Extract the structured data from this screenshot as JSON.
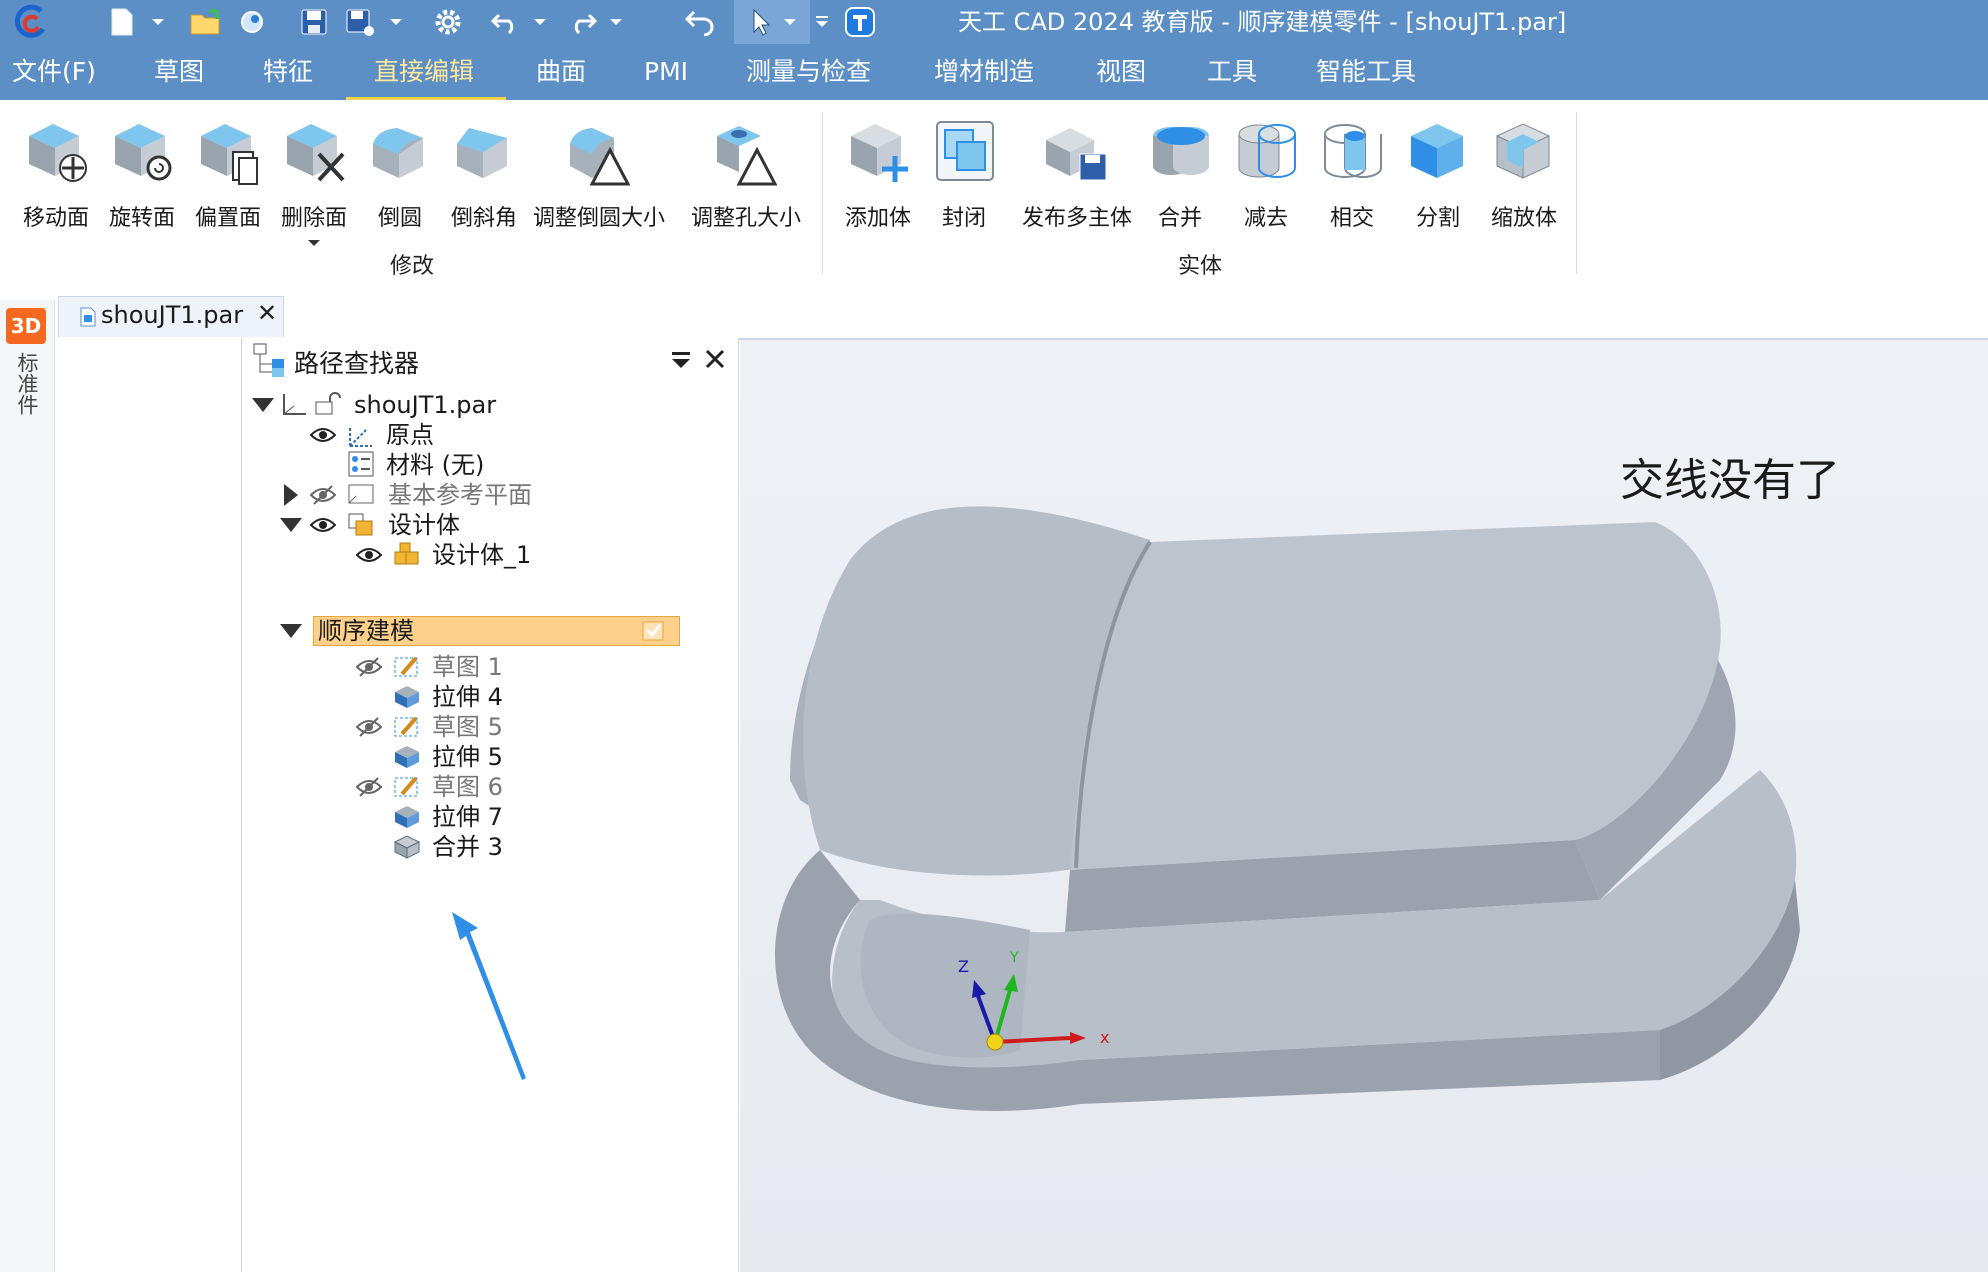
{
  "app": {
    "title": "天工 CAD 2024 教育版 - 顺序建模零件 - [shouJT1.par]"
  },
  "quick_access": [
    "app-logo-icon",
    "new-file-icon",
    "dropdown-arrow-icon",
    "open-folder-icon",
    "globe-icon",
    "save-icon",
    "save-as-icon",
    "dropdown-arrow-icon",
    "settings-gear-icon",
    "undo-icon",
    "dropdown-arrow-icon",
    "redo-icon",
    "dropdown-arrow-icon",
    "rollback-icon",
    "select-cursor-icon",
    "customize-qa-icon",
    "t-brand-icon"
  ],
  "menu": {
    "items": [
      "文件(F)",
      "草图",
      "特征",
      "直接编辑",
      "曲面",
      "PMI",
      "测量与检查",
      "增材制造",
      "视图",
      "工具",
      "智能工具"
    ],
    "active": "直接编辑"
  },
  "ribbon": {
    "modify_group": {
      "label": "修改",
      "buttons": [
        "移动面",
        "旋转面",
        "偏置面",
        "删除面",
        "倒圆",
        "倒斜角",
        "调整倒圆大小",
        "调整孔大小"
      ]
    },
    "solid_group": {
      "label": "实体",
      "buttons": [
        "添加体",
        "封闭",
        "发布多主体",
        "合并",
        "减去",
        "相交",
        "分割",
        "缩放体"
      ]
    }
  },
  "document_tab": {
    "label": "shouJT1.par",
    "close": "✕"
  },
  "side_strip": {
    "badge": "3D",
    "label": "标准件"
  },
  "pathfinder": {
    "title": "路径查找器",
    "items": [
      {
        "label": "shouJT1.par",
        "dimmed": false
      },
      {
        "label": "原点",
        "dimmed": false
      },
      {
        "label": "材料 (无)",
        "dimmed": false
      },
      {
        "label": "基本参考平面",
        "dimmed": true
      },
      {
        "label": "设计体",
        "dimmed": false
      },
      {
        "label": "设计体_1",
        "dimmed": false
      },
      {
        "label": "顺序建模",
        "dimmed": false,
        "selected": true
      },
      {
        "label": "草图 1",
        "dimmed": true
      },
      {
        "label": "拉伸 4",
        "dimmed": false
      },
      {
        "label": "草图 5",
        "dimmed": true
      },
      {
        "label": "拉伸 5",
        "dimmed": false
      },
      {
        "label": "草图 6",
        "dimmed": true
      },
      {
        "label": "拉伸 7",
        "dimmed": false
      },
      {
        "label": "合并 3",
        "dimmed": false
      }
    ]
  },
  "viewport": {
    "annotation": "交线没有了",
    "triad": {
      "x": "x",
      "y": "Y",
      "z": "Z"
    }
  },
  "colors": {
    "titlebar": "#5b8fc6",
    "active_menu": "#ffe89a",
    "selection": "#fdd08c",
    "annotation_arrow": "#2f8fe6",
    "part_face": "#b3bcc6"
  }
}
